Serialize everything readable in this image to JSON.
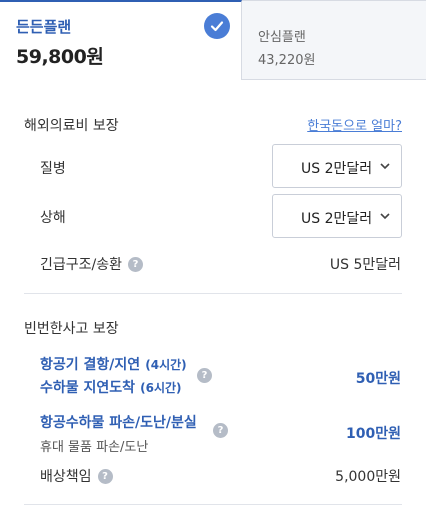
{
  "tabs": [
    {
      "name": "든든플랜",
      "price": "59,800원",
      "selected": true
    },
    {
      "name": "안심플랜",
      "price": "43,220원",
      "selected": false
    }
  ],
  "medical": {
    "title": "해외의료비 보장",
    "link": "한국돈으로 얼마?",
    "rows": {
      "disease": {
        "label": "질병",
        "value": "US 2만달러"
      },
      "injury": {
        "label": "상해",
        "value": "US 2만달러"
      },
      "rescue": {
        "label": "긴급구조/송환",
        "value": "US 5만달러"
      }
    }
  },
  "accident": {
    "title": "빈번한사고 보장",
    "flight": {
      "line1_main": "항공기 결항/지연",
      "line1_sub": "(4시간)",
      "line2_main": "수하물 지연도착",
      "line2_sub": "(6시간)",
      "value": "50만원"
    },
    "baggage": {
      "line1": "항공수하물 파손/도난/분실",
      "line2": "휴대 물품 파손/도난",
      "value": "100만원"
    },
    "liability": {
      "label": "배상책임",
      "value": "5,000만원"
    }
  },
  "help_icon_text": "?",
  "colors": {
    "accent": "#2f5fb3",
    "badge": "#4a7dd6",
    "help": "#b5bcc7"
  }
}
